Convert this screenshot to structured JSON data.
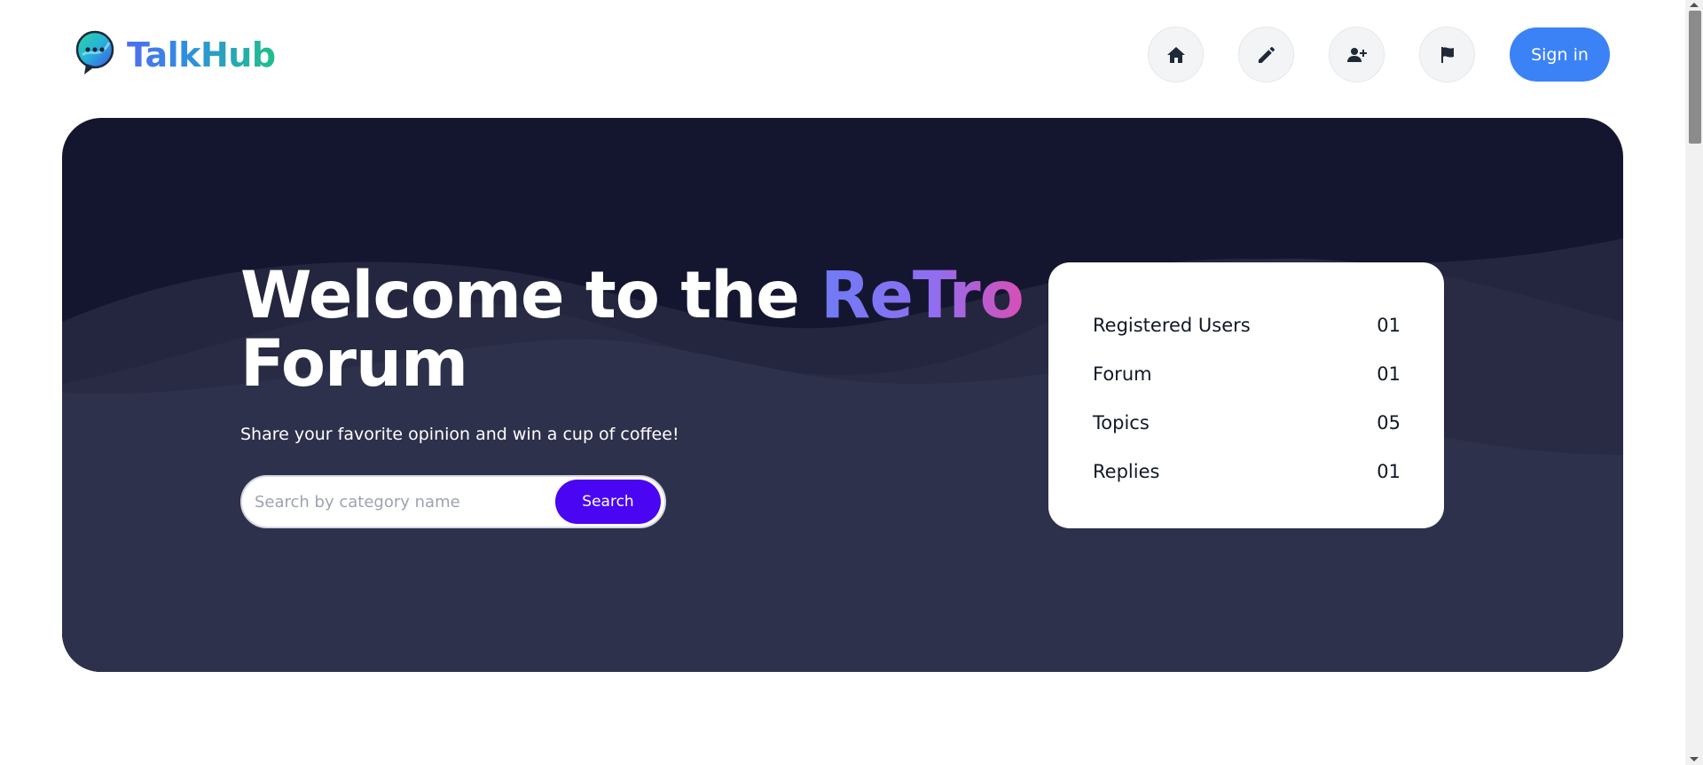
{
  "header": {
    "logo_text": "TalkHub",
    "nav": [
      {
        "name": "home-icon"
      },
      {
        "name": "pencil-icon"
      },
      {
        "name": "user-plus-icon"
      },
      {
        "name": "flag-icon"
      }
    ],
    "signin_label": "Sign in"
  },
  "hero": {
    "title_part1": "Welcome to the ",
    "title_highlight": "ReTro",
    "title_part2": "Forum",
    "subtitle": "Share your favorite opinion and win a cup of coffee!",
    "search": {
      "placeholder": "Search by category name",
      "value": "",
      "button_label": "Search"
    }
  },
  "stats": [
    {
      "label": "Registered Users",
      "value": "01"
    },
    {
      "label": "Forum",
      "value": "01"
    },
    {
      "label": "Topics",
      "value": "05"
    },
    {
      "label": "Replies",
      "value": "01"
    }
  ],
  "colors": {
    "hero_bg": "#14162f",
    "accent_blue": "#3b82f6",
    "search_button": "#4a06f2",
    "title_gradient": [
      "#6f7bf5",
      "#d94fb5"
    ]
  }
}
